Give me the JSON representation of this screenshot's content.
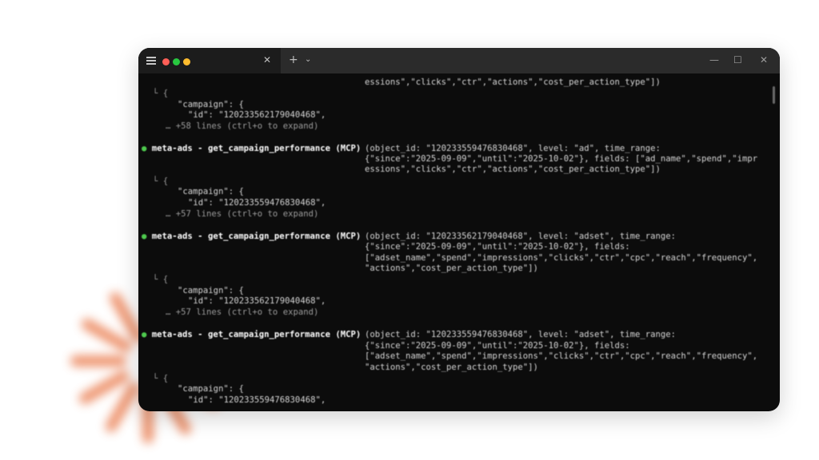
{
  "window": {
    "tab_close_glyph": "✕",
    "new_tab_glyph": "+",
    "tab_dropdown_glyph": "⌄",
    "min_glyph": "—",
    "max_glyph": "☐",
    "close_glyph": "✕"
  },
  "terminal": {
    "bullet": "●",
    "tail_first": "essions\",\"clicks\",\"ctr\",\"actions\",\"cost_per_action_type\"])",
    "results": [
      {
        "elbow": "└ {",
        "campaign": "\"campaign\": {",
        "id": "\"id\": \"120233562179040468\",",
        "more": "… +58 lines (ctrl+o to expand)"
      },
      {
        "elbow": "└ {",
        "campaign": "\"campaign\": {",
        "id": "\"id\": \"120233559476830468\",",
        "more": "… +57 lines (ctrl+o to expand)"
      },
      {
        "elbow": "└ {",
        "campaign": "\"campaign\": {",
        "id": "\"id\": \"120233562179040468\",",
        "more": "… +57 lines (ctrl+o to expand)"
      },
      {
        "elbow": "└ {",
        "campaign": "\"campaign\": {",
        "id": "\"id\": \"120233559476830468\","
      }
    ],
    "calls": [
      {
        "tool": "meta-ads - get_campaign_performance (MCP)",
        "args": [
          "(object_id: \"120233559476830468\", level: \"ad\", time_range:",
          "{\"since\":\"2025-09-09\",\"until\":\"2025-10-02\"}, fields: [\"ad_name\",\"spend\",\"impr",
          "essions\",\"clicks\",\"ctr\",\"actions\",\"cost_per_action_type\"])"
        ]
      },
      {
        "tool": "meta-ads - get_campaign_performance (MCP)",
        "args": [
          "(object_id: \"120233562179040468\", level: \"adset\", time_range:",
          "{\"since\":\"2025-09-09\",\"until\":\"2025-10-02\"}, fields:",
          "[\"adset_name\",\"spend\",\"impressions\",\"clicks\",\"ctr\",\"cpc\",\"reach\",\"frequency\",",
          "\"actions\",\"cost_per_action_type\"])"
        ]
      },
      {
        "tool": "meta-ads - get_campaign_performance (MCP)",
        "args": [
          "(object_id: \"120233559476830468\", level: \"adset\", time_range:",
          "{\"since\":\"2025-09-09\",\"until\":\"2025-10-02\"}, fields:",
          "[\"adset_name\",\"spend\",\"impressions\",\"clicks\",\"ctr\",\"cpc\",\"reach\",\"frequency\",",
          "\"actions\",\"cost_per_action_type\"])"
        ]
      }
    ]
  }
}
